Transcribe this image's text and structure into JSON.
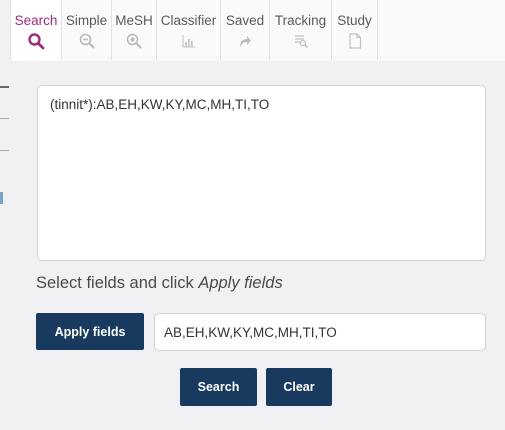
{
  "tabs": [
    {
      "label": "Search",
      "icon": "search-icon",
      "active": true
    },
    {
      "label": "Simple",
      "icon": "zoom-out-icon",
      "active": false
    },
    {
      "label": "MeSH",
      "icon": "zoom-in-icon",
      "active": false
    },
    {
      "label": "Classifier",
      "icon": "bar-chart-icon",
      "active": false
    },
    {
      "label": "Saved",
      "icon": "share-arrow-icon",
      "active": false
    },
    {
      "label": "Tracking",
      "icon": "list-search-icon",
      "active": false
    },
    {
      "label": "Study",
      "icon": "document-icon",
      "active": false
    }
  ],
  "colors": {
    "active_tab": "#a02a7e",
    "button_bg": "#173a5e",
    "panel_bg": "#f1f1f4"
  },
  "query": {
    "text": "(tinnit*):AB,EH,KW,KY,MC,MH,TI,TO"
  },
  "fields": {
    "caption_prefix": "Select fields and click ",
    "caption_emphasis": "Apply fields",
    "apply_label": "Apply fields",
    "value": "AB,EH,KW,KY,MC,MH,TI,TO"
  },
  "actions": {
    "search_label": "Search",
    "clear_label": "Clear"
  }
}
